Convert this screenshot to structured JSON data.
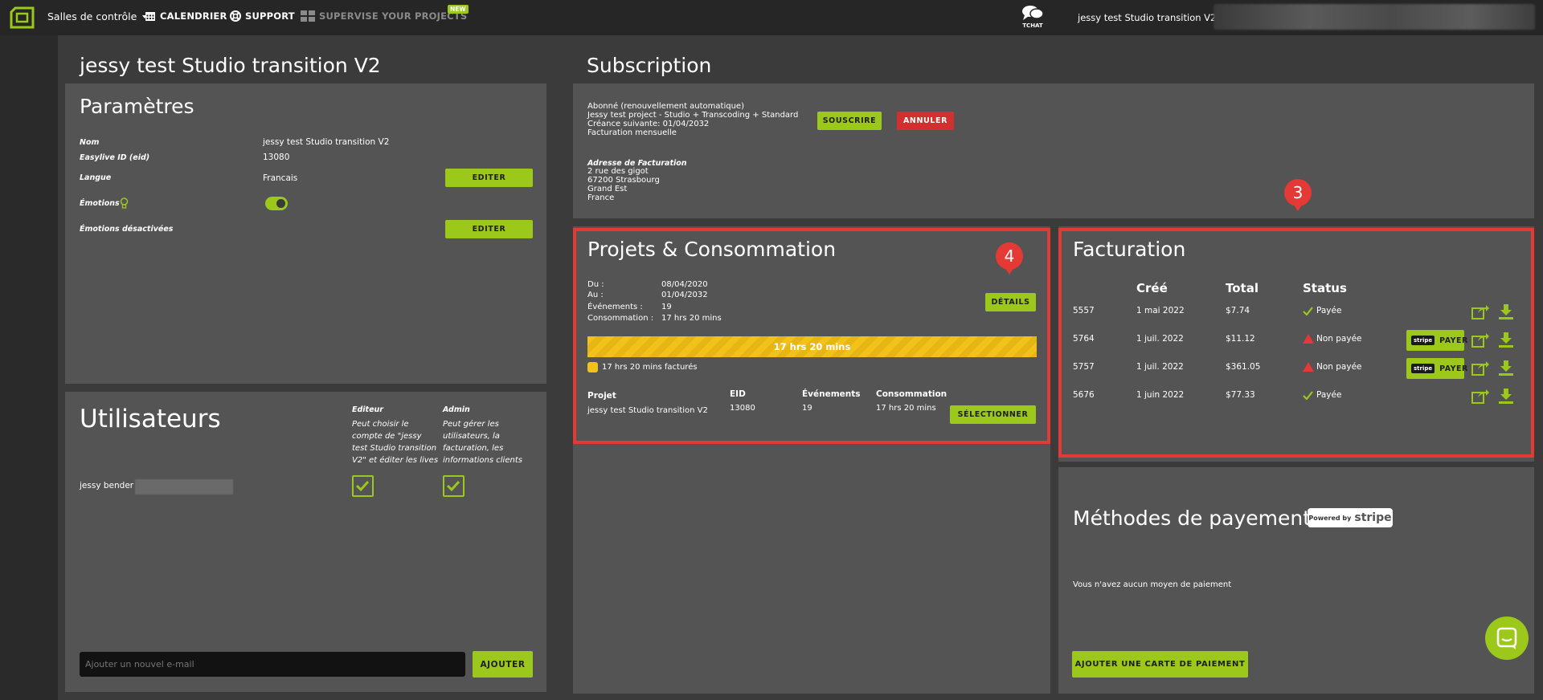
{
  "nav": {
    "control_rooms": "Salles de contrôle",
    "calendar": "CALENDRIER",
    "support": "SUPPORT",
    "supervise": "SUPERVISE YOUR PROJECTS",
    "new_badge": "NEW",
    "tchat": "TCHAT",
    "user_menu": "jessy test Studio transition V2"
  },
  "page_title": "jessy test Studio transition V2",
  "parametres": {
    "title": "Paramètres",
    "nom_label": "Nom",
    "nom_value": "jessy test Studio transition V2",
    "eid_label": "Easylive ID (eid)",
    "eid_value": "13080",
    "langue_label": "Langue",
    "langue_value": "Francais",
    "editer_1": "EDITER",
    "emotions_label": "Émotions",
    "emotions_enabled": true,
    "emotions_off_label": "Émotions désactivées",
    "editer_2": "EDITER"
  },
  "utilisateurs": {
    "title": "Utilisateurs",
    "editeur_head": "Editeur",
    "editeur_desc_1": "Peut choisir le",
    "editeur_desc_2": "compte de \"jessy",
    "editeur_desc_3": "test Studio transition",
    "editeur_desc_4": "V2\" et éditer les lives",
    "admin_head": "Admin",
    "admin_desc_1": "Peut gérer les",
    "admin_desc_2": "utilisateurs, la",
    "admin_desc_3": "facturation, les",
    "admin_desc_4": "informations clients",
    "user_name": "jessy bender",
    "editor_checked": true,
    "admin_checked": true,
    "email_placeholder": "Ajouter un nouvel e-mail",
    "add_button": "AJOUTER"
  },
  "subscription": {
    "title": "Subscription",
    "line1": "Abonné (renouvellement automatique)",
    "line2": "Jessy test project - Studio + Transcoding + Standard",
    "line3": "Créance suivante: 01/04/2032",
    "line4": "Facturation mensuelle",
    "subscribe_button": "SOUSCRIRE",
    "cancel_button": "ANNULER",
    "billing_label": "Adresse de Facturation",
    "address1": "2 rue des gigot",
    "address2": "67200 Strasbourg",
    "address3": "Grand Est",
    "address4": "France"
  },
  "projets": {
    "title": "Projets & Consommation",
    "du_label": "Du :",
    "du_value": "08/04/2020",
    "au_label": "Au :",
    "au_value": "01/04/2032",
    "events_label": "Événements :",
    "events_value": "19",
    "conso_label": "Consommation :",
    "conso_value": "17 hrs 20 mins",
    "details_button": "DÉTAILS",
    "progress_text": "17 hrs 20 mins",
    "progress_fraction": 1.0,
    "billed_text": "17 hrs 20 mins facturés",
    "col_projet": "Projet",
    "col_eid": "EID",
    "col_events": "Événements",
    "col_conso": "Consommation",
    "row_projet": "jessy test Studio transition V2",
    "row_eid": "13080",
    "row_events": "19",
    "row_conso": "17 hrs 20 mins",
    "select_button": "SÉLECTIONNER",
    "marker": "4"
  },
  "facturation": {
    "title": "Facturation",
    "col_cree": "Créé",
    "col_total": "Total",
    "col_status": "Status",
    "marker": "3",
    "payer_label": "PAYER",
    "stripe_mini": "stripe",
    "invoices": [
      {
        "id": "5557",
        "date": "1 mai 2022",
        "total": "$7.74",
        "status": "Payée",
        "paid": true
      },
      {
        "id": "5764",
        "date": "1 juil. 2022",
        "total": "$11.12",
        "status": "Non payée",
        "paid": false
      },
      {
        "id": "5757",
        "date": "1 juil. 2022",
        "total": "$361.05",
        "status": "Non payée",
        "paid": false
      },
      {
        "id": "5676",
        "date": "1 juin 2022",
        "total": "$77.33",
        "status": "Payée",
        "paid": true
      }
    ]
  },
  "paiement": {
    "title": "Méthodes de payement",
    "powered_by": "Powered by",
    "stripe": "stripe",
    "empty_text": "Vous n'avez aucun moyen de paiement",
    "add_card_button": "AJOUTER UNE CARTE DE PAIEMENT"
  },
  "colors": {
    "accent": "#9bc81a",
    "danger": "#d32f2f",
    "progress": "#f2c21a",
    "panel": "#545454",
    "background": "#3b3b3b",
    "topbar": "#262626"
  }
}
